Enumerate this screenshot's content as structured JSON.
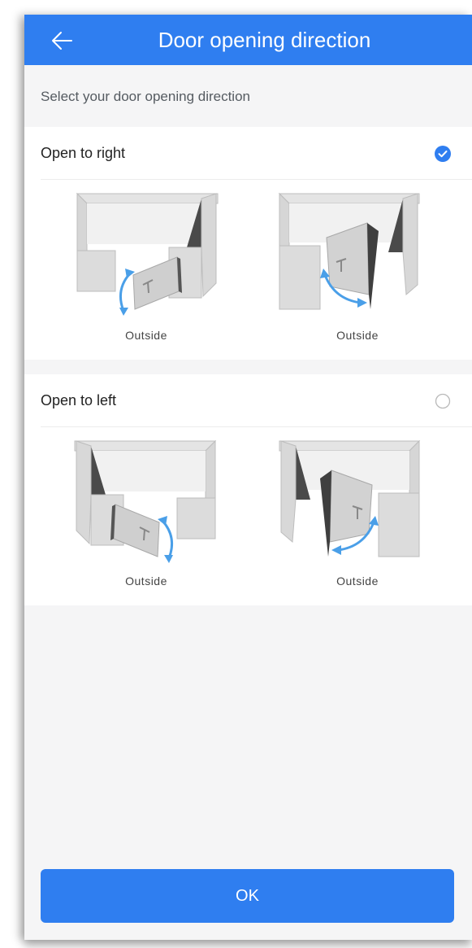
{
  "header": {
    "title": "Door opening direction",
    "back_icon": "arrow-left-icon"
  },
  "subtitle": "Select your door opening direction",
  "options": [
    {
      "label": "Open to right",
      "selected": true,
      "variants": [
        {
          "caption": "Outside"
        },
        {
          "caption": "Outside"
        }
      ]
    },
    {
      "label": "Open to left",
      "selected": false,
      "variants": [
        {
          "caption": "Outside"
        },
        {
          "caption": "Outside"
        }
      ]
    }
  ],
  "ok_button": {
    "label": "OK"
  },
  "colors": {
    "accent": "#2f7ef0",
    "background": "#f5f5f6",
    "wall": "#dedede",
    "wall_shadow": "#555555",
    "arrow": "#4a9fe8"
  }
}
